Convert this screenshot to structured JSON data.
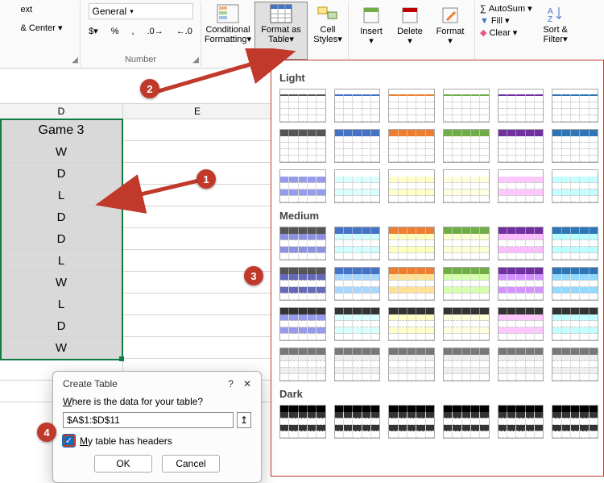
{
  "ribbon": {
    "alignment": {
      "wrap": "ext",
      "merge": "& Center"
    },
    "number": {
      "format": "General",
      "label": "Number"
    },
    "styles": {
      "conditional": "Conditional\nFormatting",
      "format_table": "Format as\nTable",
      "cell_styles": "Cell\nStyles"
    },
    "cells": {
      "insert": "Insert",
      "delete": "Delete",
      "format": "Format"
    },
    "editing": {
      "autosum": "AutoSum",
      "fill": "Fill",
      "clear": "Clear",
      "sort": "Sort &\nFilter"
    }
  },
  "sheet": {
    "cols": {
      "d": "D",
      "e": "E"
    },
    "header": "Game 3",
    "rows": [
      "W",
      "D",
      "L",
      "D",
      "D",
      "L",
      "W",
      "L",
      "D",
      "W"
    ]
  },
  "gallery": {
    "light": "Light",
    "medium": "Medium",
    "dark": "Dark"
  },
  "dialog": {
    "title": "Create Table",
    "help": "?",
    "close": "✕",
    "prompt": "Where is the data for your table?",
    "range": "$A$1:$D$11",
    "headers": "My table has headers",
    "ok": "OK",
    "cancel": "Cancel"
  },
  "callouts": {
    "c1": "1",
    "c2": "2",
    "c3": "3",
    "c4": "4"
  }
}
